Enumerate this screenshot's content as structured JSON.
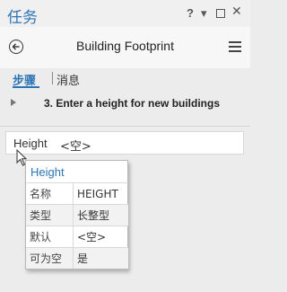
{
  "window": {
    "title": "任务",
    "help_label": "?",
    "menu_label": "▾",
    "close_label": "✕"
  },
  "header": {
    "title": "Building Footprint"
  },
  "tabs": {
    "steps": "步骤",
    "messages": "消息"
  },
  "step": {
    "label": "3.  Enter a height for new buildings"
  },
  "field": {
    "name": "Height",
    "value": "<空>"
  },
  "tooltip": {
    "title": "Height",
    "rows": [
      {
        "key": "名称",
        "value": "HEIGHT"
      },
      {
        "key": "类型",
        "value": "长整型"
      },
      {
        "key": "默认",
        "value": "<空>"
      },
      {
        "key": "可为空",
        "value": "是"
      }
    ]
  },
  "colors": {
    "accent": "#2e75b6",
    "background": "#ececec"
  }
}
